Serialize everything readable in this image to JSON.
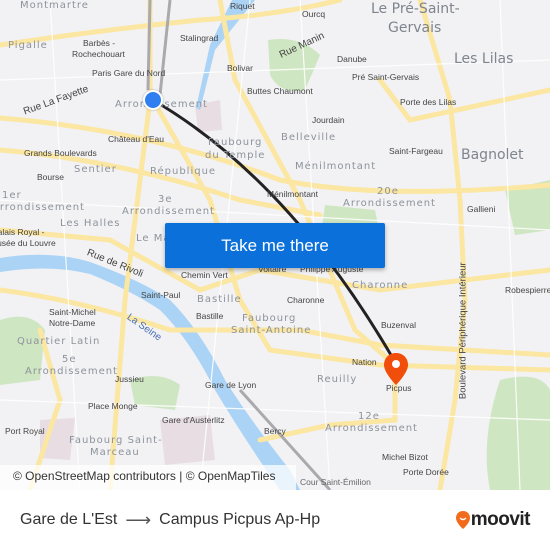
{
  "map": {
    "labels": [
      "Montmartre",
      "Riquet",
      "Ourcq",
      "Le Pré-Saint-",
      "Gervais",
      "Pigalle",
      "Barbès -",
      "Rochechouart",
      "Stalingrad",
      "Rue Manin",
      "Danube",
      "Les Lilas",
      "Paris Gare du Nord",
      "Bolivar",
      "Pré Saint-Gervais",
      "Rue La Fayette",
      "Buttes Chaumont",
      "Porte des Lilas",
      "Arrondissement",
      "Jourdain",
      "Château d'Eau",
      "Faubourg",
      "du Temple",
      "Belleville",
      "Saint-Fargeau",
      "Bagnolet",
      "Grands Boulevards",
      "Sentier",
      "République",
      "Ménilmontant",
      "Bourse",
      "Ménilmontant",
      "20e",
      "Arrondissement",
      "1er",
      "Arrondissement",
      "3e",
      "Arrondissement",
      "Gallieni",
      "Les Halles",
      "Palais Royal -",
      "Musée du Louvre",
      "Le Marais",
      "Boulevard Périphérique Intérieur",
      "Rue de Rivoli",
      "Chemin Vert",
      "Voltaire",
      "Philippe Auguste",
      "Charonne",
      "Robespierre",
      "Saint-Paul",
      "Bastille",
      "Charonne",
      "Bastille",
      "Saint-Michel",
      "Notre-Dame",
      "Faubourg",
      "Saint-Antoine",
      "La Seine",
      "Buzenval",
      "Quartier Latin",
      "5e",
      "Arrondissement",
      "Nation",
      "Picpus",
      "Reuilly",
      "Jussieu",
      "Gare de Lyon",
      "Place Monge",
      "Gare d'Austerlitz",
      "12e",
      "Arrondissement",
      "Port Royal",
      "Bercy",
      "Faubourg Saint-",
      "Marceau",
      "Michel Bizot",
      "Porte Dorée",
      "Cour Saint-Émilion"
    ],
    "cta_label": "Take me there",
    "attribution": "© OpenStreetMap contributors | © OpenMapTiles",
    "origin_marker_color": "#2f7ff0",
    "destination_marker_color": "#f04e0a",
    "route_color": "#222222"
  },
  "footer": {
    "origin": "Gare de L'Est",
    "destination": "Campus Picpus Ap-Hp",
    "logo": "moovit",
    "brand_color": "#f26b1d"
  }
}
